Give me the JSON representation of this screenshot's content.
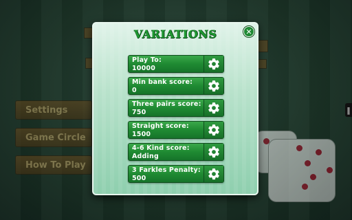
{
  "background": {
    "menu_buttons": [
      "Settings",
      "Game Circle",
      "How To Play"
    ]
  },
  "dialog": {
    "title": "VARIATIONS",
    "close_icon": "close-icon",
    "settings": [
      {
        "label": "Play To:",
        "value": "10000"
      },
      {
        "label": "Min bank score:",
        "value": "0"
      },
      {
        "label": "Three pairs score:",
        "value": "750"
      },
      {
        "label": "Straight score:",
        "value": "1500"
      },
      {
        "label": "4-6 Kind score:",
        "value": "Adding"
      },
      {
        "label": "3 Farkles Penalty:",
        "value": "500"
      }
    ],
    "row_icon": "gear-icon"
  },
  "colors": {
    "title_green": "#1f9a32",
    "row_green": "#1f8a32",
    "panel_mint": "#b8e2cb",
    "pip_red": "#b0102a"
  }
}
